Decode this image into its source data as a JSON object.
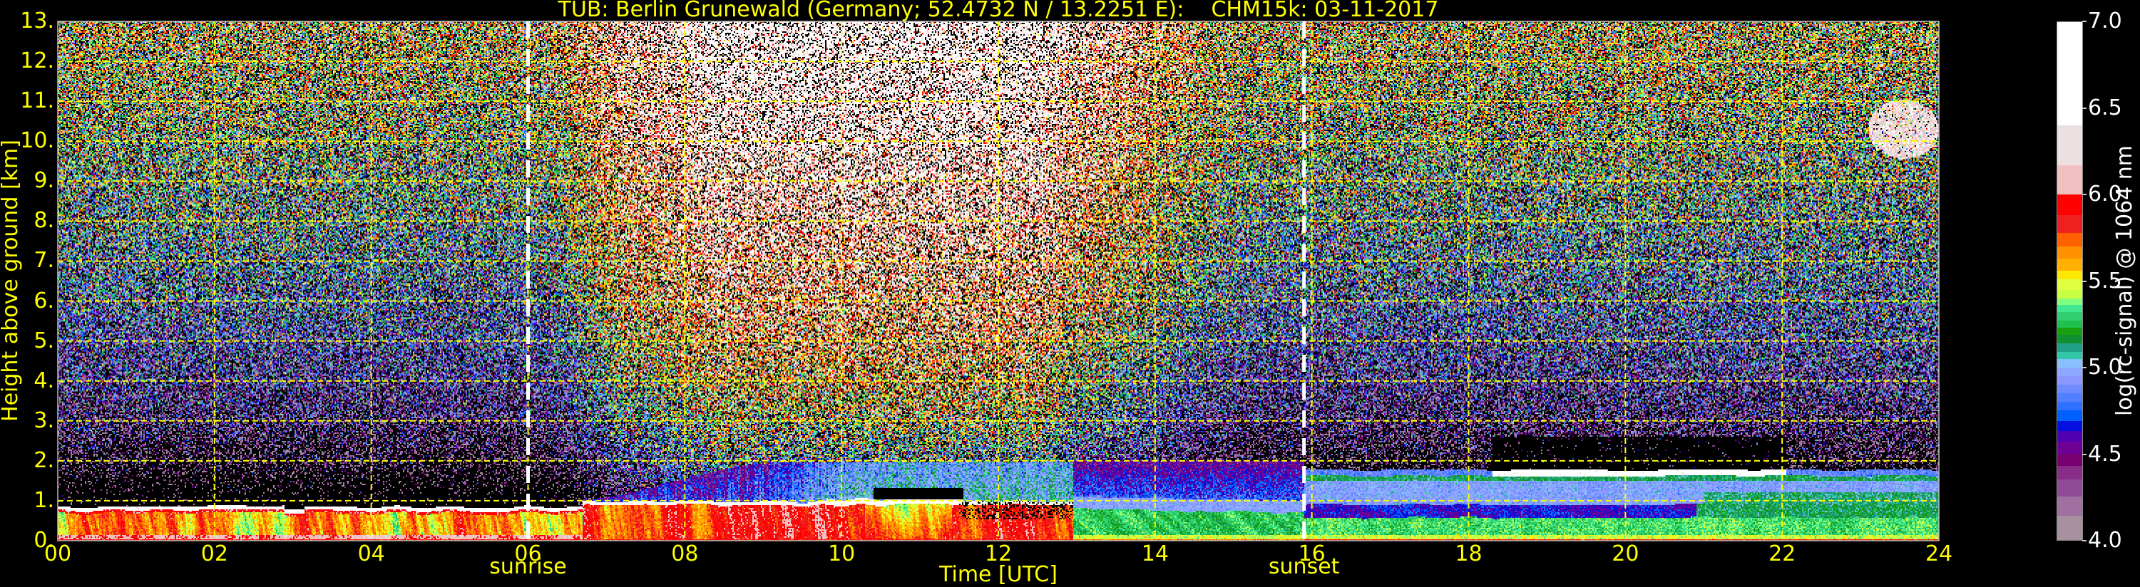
{
  "chart_data": {
    "type": "heatmap",
    "title": "TUB: Berlin Grunewald (Germany; 52.4732 N / 13.2251 E):    CHM15k: 03-11-2017",
    "xlabel": "Time [UTC]",
    "ylabel": "Height above ground [km]",
    "xlim": [
      0,
      24
    ],
    "ylim": [
      0,
      13
    ],
    "xticks": [
      {
        "value": 0,
        "label": "00"
      },
      {
        "value": 2,
        "label": "02"
      },
      {
        "value": 4,
        "label": "04"
      },
      {
        "value": 6,
        "label": "06"
      },
      {
        "value": 8,
        "label": "08"
      },
      {
        "value": 10,
        "label": "10"
      },
      {
        "value": 12,
        "label": "12"
      },
      {
        "value": 14,
        "label": "14"
      },
      {
        "value": 16,
        "label": "16"
      },
      {
        "value": 18,
        "label": "18"
      },
      {
        "value": 20,
        "label": "20"
      },
      {
        "value": 22,
        "label": "22"
      },
      {
        "value": 24,
        "label": "24"
      }
    ],
    "yticks": [
      {
        "value": 0,
        "label": "0."
      },
      {
        "value": 1,
        "label": "1."
      },
      {
        "value": 2,
        "label": "2."
      },
      {
        "value": 3,
        "label": "3."
      },
      {
        "value": 4,
        "label": "4."
      },
      {
        "value": 5,
        "label": "5."
      },
      {
        "value": 6,
        "label": "6."
      },
      {
        "value": 7,
        "label": "7."
      },
      {
        "value": 8,
        "label": "8."
      },
      {
        "value": 9,
        "label": "9."
      },
      {
        "value": 10,
        "label": "10."
      },
      {
        "value": 11,
        "label": "11."
      },
      {
        "value": 12,
        "label": "12."
      },
      {
        "value": 13,
        "label": "13."
      }
    ],
    "grid": true,
    "grid_color": "#ffff00",
    "text_color": "#ffff00",
    "annotations": [
      {
        "label": "sunrise",
        "time": 6.0,
        "line_color": "#ffffff"
      },
      {
        "label": "sunset",
        "time": 15.9,
        "line_color": "#ffffff"
      }
    ],
    "colorbar": {
      "label": "log(rc-signal) @ 1064 nm",
      "range": [
        4.0,
        7.0
      ],
      "ticks": [
        {
          "value": 4.0,
          "label": "4.0"
        },
        {
          "value": 4.5,
          "label": "4.5"
        },
        {
          "value": 5.0,
          "label": "5.0"
        },
        {
          "value": 5.5,
          "label": "5.5"
        },
        {
          "value": 6.0,
          "label": "6.0"
        },
        {
          "value": 6.5,
          "label": "6.5"
        },
        {
          "value": 7.0,
          "label": "7.0"
        }
      ],
      "below_range_color": "#000000",
      "colormap": [
        {
          "from": 4.0,
          "color": "#a8909f"
        },
        {
          "from": 4.14,
          "color": "#a070a0"
        },
        {
          "from": 4.25,
          "color": "#904a98"
        },
        {
          "from": 4.35,
          "color": "#882c88"
        },
        {
          "from": 4.43,
          "color": "#780070"
        },
        {
          "from": 4.5,
          "color": "#6e0098"
        },
        {
          "from": 4.57,
          "color": "#5000b0"
        },
        {
          "from": 4.63,
          "color": "#0010e0"
        },
        {
          "from": 4.69,
          "color": "#0060ff"
        },
        {
          "from": 4.75,
          "color": "#3070ff"
        },
        {
          "from": 4.8,
          "color": "#5080ff"
        },
        {
          "from": 4.85,
          "color": "#6e8aff"
        },
        {
          "from": 4.9,
          "color": "#8a98ff"
        },
        {
          "from": 4.95,
          "color": "#8fa8ff"
        },
        {
          "from": 5.0,
          "color": "#88c0ff"
        },
        {
          "from": 5.05,
          "color": "#30c8a8"
        },
        {
          "from": 5.09,
          "color": "#20a088"
        },
        {
          "from": 5.14,
          "color": "#109030"
        },
        {
          "from": 5.19,
          "color": "#18a010"
        },
        {
          "from": 5.23,
          "color": "#20c050"
        },
        {
          "from": 5.27,
          "color": "#30d070"
        },
        {
          "from": 5.32,
          "color": "#40e890"
        },
        {
          "from": 5.36,
          "color": "#80ff80"
        },
        {
          "from": 5.4,
          "color": "#c8ff40"
        },
        {
          "from": 5.45,
          "color": "#e0ff40"
        },
        {
          "from": 5.51,
          "color": "#ffe800"
        },
        {
          "from": 5.56,
          "color": "#ffb000"
        },
        {
          "from": 5.63,
          "color": "#ff9000"
        },
        {
          "from": 5.7,
          "color": "#ff6000"
        },
        {
          "from": 5.78,
          "color": "#f02020"
        },
        {
          "from": 5.88,
          "color": "#ff0000"
        },
        {
          "from": 6.0,
          "color": "#f0c0c0"
        },
        {
          "from": 6.17,
          "color": "#ece0e0"
        },
        {
          "from": 6.4,
          "color": "#ffffff"
        }
      ]
    }
  }
}
